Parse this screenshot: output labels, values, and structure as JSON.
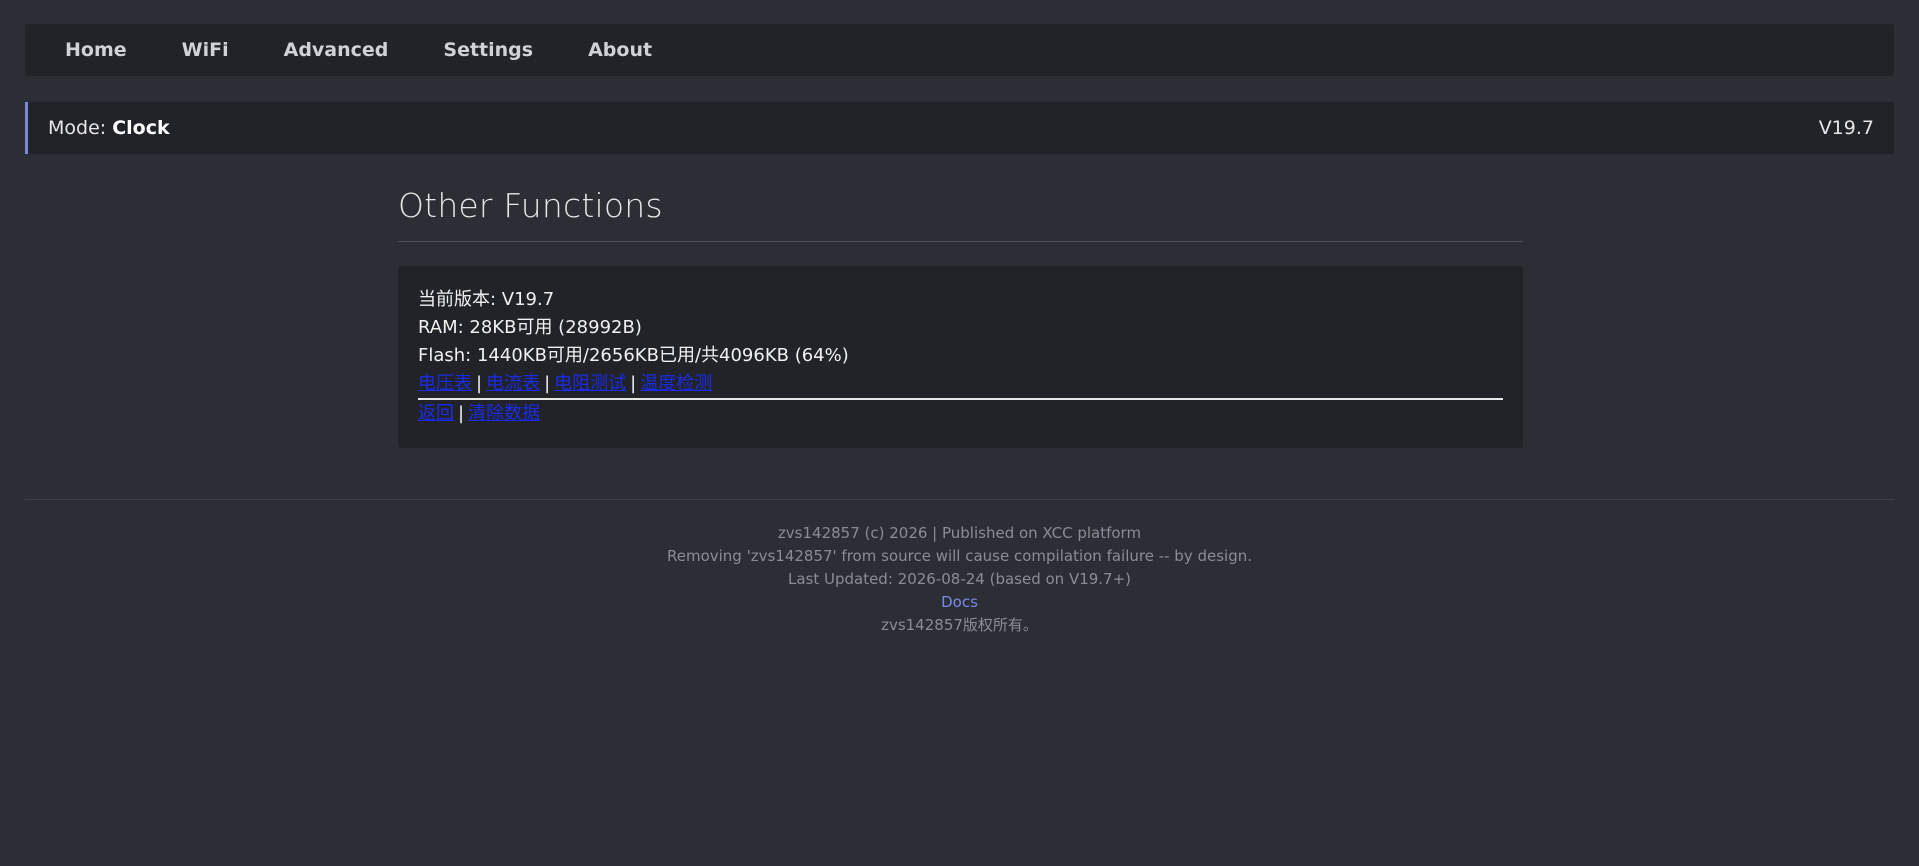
{
  "nav": {
    "items": [
      {
        "label": "Home"
      },
      {
        "label": "WiFi"
      },
      {
        "label": "Advanced"
      },
      {
        "label": "Settings"
      },
      {
        "label": "About"
      }
    ]
  },
  "mode": {
    "prefix": "Mode: ",
    "value": "Clock",
    "version": "V19.7"
  },
  "main": {
    "title": "Other Functions",
    "info": {
      "version_line": "当前版本: V19.7",
      "ram_line": "RAM: 28KB可用 (28992B)",
      "flash_line": "Flash: 1440KB可用/2656KB已用/共4096KB (64%)"
    },
    "links_row1": [
      "电压表",
      "电流表",
      "电阻测试",
      "温度检测"
    ],
    "links_row2": [
      "返回",
      "清除数据"
    ],
    "separator": "|"
  },
  "footer": {
    "line1": "zvs142857 (c) 2026 | Published on XCC platform",
    "line2": "Removing 'zvs142857' from source will cause compilation failure -- by design.",
    "line3": "Last Updated: 2026-08-24 (based on V19.7+)",
    "docs_link": "Docs",
    "line5": "zvs142857版权所有。"
  },
  "colors": {
    "background": "#2b2e34",
    "panel": "#212328",
    "accent": "#7b88d4",
    "link": "#1a2be8"
  }
}
